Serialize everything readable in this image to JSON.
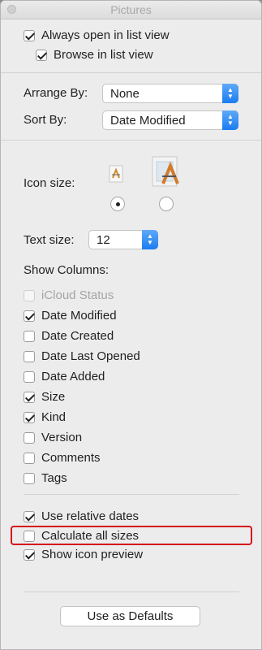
{
  "window": {
    "title": "Pictures"
  },
  "top_options": [
    {
      "label": "Always open in list view",
      "checked": true
    },
    {
      "label": "Browse in list view",
      "checked": true
    }
  ],
  "arrange_by": {
    "label": "Arrange By:",
    "value": "None"
  },
  "sort_by": {
    "label": "Sort By:",
    "value": "Date Modified"
  },
  "icon_size": {
    "label": "Icon size:",
    "small_icon": "app-icon",
    "large_icon": "app-icon",
    "selected": "small"
  },
  "text_size": {
    "label": "Text size:",
    "value": "12"
  },
  "show_columns": {
    "label": "Show Columns:",
    "items": [
      {
        "label": "iCloud Status",
        "checked": false,
        "disabled": true
      },
      {
        "label": "Date Modified",
        "checked": true
      },
      {
        "label": "Date Created",
        "checked": false
      },
      {
        "label": "Date Last Opened",
        "checked": false
      },
      {
        "label": "Date Added",
        "checked": false
      },
      {
        "label": "Size",
        "checked": true
      },
      {
        "label": "Kind",
        "checked": true
      },
      {
        "label": "Version",
        "checked": false
      },
      {
        "label": "Comments",
        "checked": false
      },
      {
        "label": "Tags",
        "checked": false
      }
    ]
  },
  "bottom_options": [
    {
      "label": "Use relative dates",
      "checked": true
    },
    {
      "label": "Calculate all sizes",
      "checked": false
    },
    {
      "label": "Show icon preview",
      "checked": true
    }
  ],
  "defaults_button": {
    "label": "Use as Defaults"
  },
  "colors": {
    "accent": "#1b7cf2",
    "highlight": "#d4141b"
  }
}
